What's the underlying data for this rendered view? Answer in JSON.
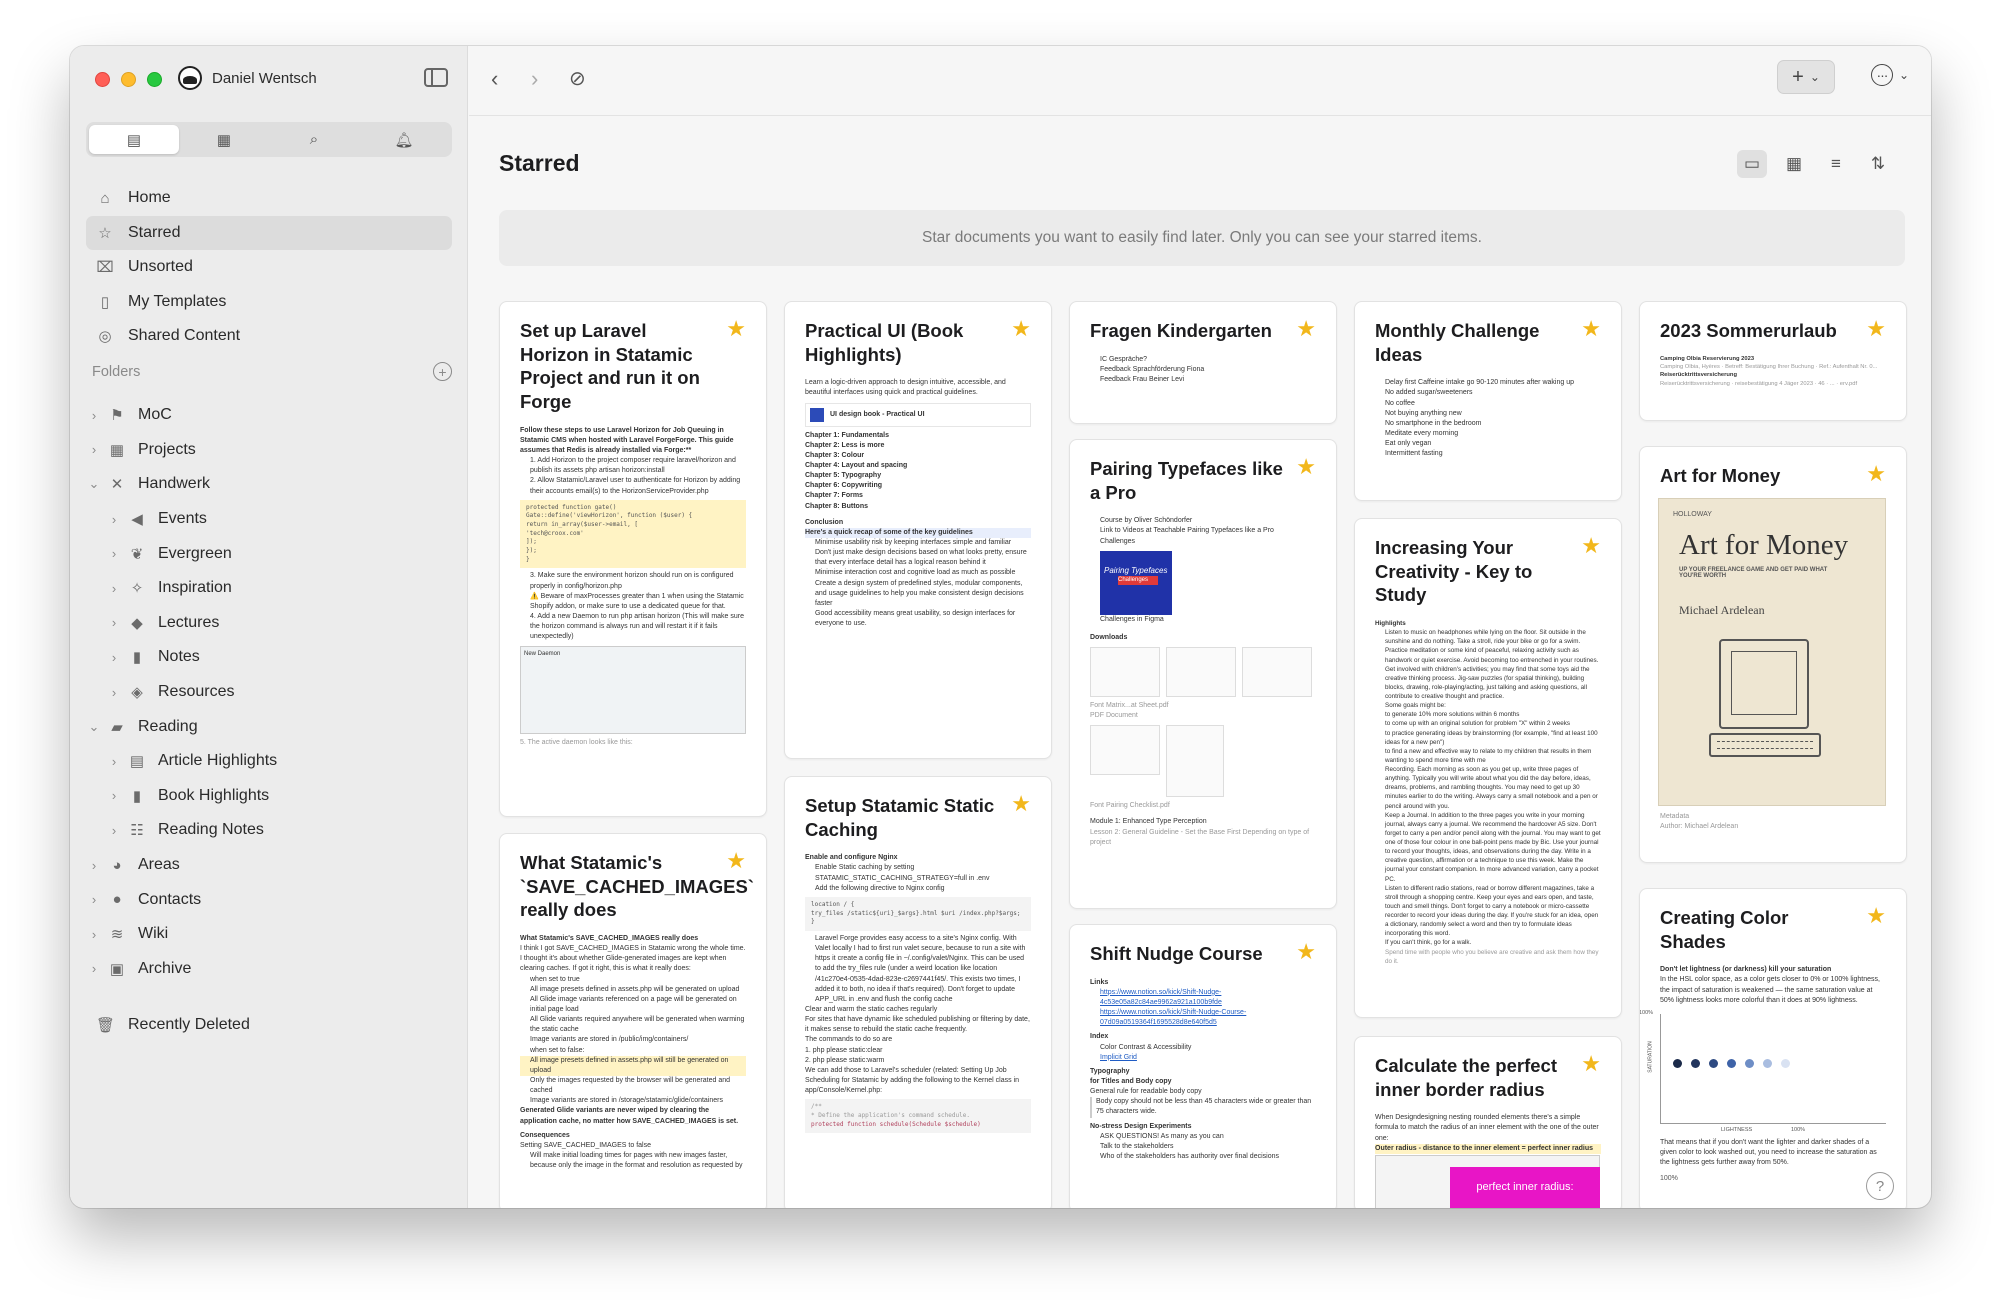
{
  "window": {
    "user_name": "Daniel Wentsch"
  },
  "sidebar": {
    "nav": [
      {
        "label": "Home",
        "icon": "home-icon"
      },
      {
        "label": "Starred",
        "icon": "star-icon"
      },
      {
        "label": "Unsorted",
        "icon": "inbox-icon"
      },
      {
        "label": "My Templates",
        "icon": "template-icon"
      },
      {
        "label": "Shared Content",
        "icon": "shared-icon"
      }
    ],
    "folders_label": "Folders",
    "tree": [
      {
        "label": "MoC",
        "level": 1,
        "icon": "signpost-icon"
      },
      {
        "label": "Projects",
        "level": 1,
        "icon": "calendar-grid-icon"
      },
      {
        "label": "Handwerk",
        "level": 1,
        "icon": "tools-icon"
      },
      {
        "label": "Events",
        "level": 2,
        "icon": "megaphone-icon"
      },
      {
        "label": "Evergreen",
        "level": 2,
        "icon": "leaf-icon"
      },
      {
        "label": "Inspiration",
        "level": 2,
        "icon": "sparkle-icon"
      },
      {
        "label": "Lectures",
        "level": 2,
        "icon": "graduation-cap-icon"
      },
      {
        "label": "Notes",
        "level": 2,
        "icon": "notebook-icon"
      },
      {
        "label": "Resources",
        "level": 2,
        "icon": "box-icon"
      },
      {
        "label": "Reading",
        "level": 1,
        "icon": "book-open-icon"
      },
      {
        "label": "Article Highlights",
        "level": 2,
        "icon": "newspaper-icon"
      },
      {
        "label": "Book Highlights",
        "level": 2,
        "icon": "bookmark-icon"
      },
      {
        "label": "Reading Notes",
        "level": 2,
        "icon": "checklist-icon"
      },
      {
        "label": "Areas",
        "level": 1,
        "icon": "pie-chart-icon"
      },
      {
        "label": "Contacts",
        "level": 1,
        "icon": "person-icon"
      },
      {
        "label": "Wiki",
        "level": 1,
        "icon": "layers-icon"
      },
      {
        "label": "Archive",
        "level": 1,
        "icon": "archive-box-icon"
      }
    ],
    "recently_deleted": "Recently Deleted"
  },
  "main": {
    "title": "Starred",
    "banner": "Star documents you want to easily find later. Only you can see your starred items."
  },
  "cards": [
    {
      "title": "Set up Laravel Horizon in Statamic Project and run it on Forge",
      "snippet": [
        "Follow these steps to use Laravel Horizon for Job Queuing in Statamic CMS when hosted with Laravel ForgeForge. This guide assumes that Redis is already installed via Forge:**",
        "1. Add Horizon to the project composer require laravel/horizon and publish its assets php artisan horizon:install",
        "2. Allow Statamic/Laravel user to authenticate for Horizon by adding their accounts email(s) to the HorizonServiceProvider.php",
        "protected function gate()",
        "Gate::define('viewHorizon', function ($user) {",
        "return in_array($user->email, [",
        "'tech@croox.com'",
        "]);",
        "});",
        "}",
        "3. Make sure the environment horizon should run on is configured properly in config/horizon.php",
        "⚠️ Beware of maxProcesses greater than 1 when using the Statamic Shopify addon, or make sure to use a dedicated queue for that.",
        "4. Add a new Daemon to run php artisan horizon (This will make sure the horizon command is always run and will restart it if it fails unexpectedly)",
        "New Daemon",
        "5. The active daemon looks like this:"
      ]
    },
    {
      "title": "What Statamic's `SAVE_CACHED_IMAGES` really does",
      "snippet": [
        "What Statamic's SAVE_CACHED_IMAGES really does",
        "I think I got SAVE_CACHED_IMAGES in Statamic wrong the whole time. I thought it's about whether Glide-generated images are kept when clearing caches. If got it right, this is what it really does:",
        "when set to true",
        "All image presets defined in assets.php will be generated on upload",
        "All Glide image variants referenced on a page will be generated on initial page load",
        "All Glide variants required anywhere will be generated when warming the static cache",
        "Image variants are stored in /public/img/containers/",
        "when set to false:",
        "All image presets defined in assets.php will still be generated on upload",
        "Only the images requested by the browser will be generated and cached",
        "Image variants are stored in /storage/statamic/glide/containers",
        "Generated Glide variants are never wiped by clearing the application cache, no matter how SAVE_CACHED_IMAGES is set.",
        "Consequences",
        "Setting SAVE_CACHED_IMAGES to false",
        "Will make initial loading times for pages with new images faster, because only the image in the format and resolution as requested by"
      ]
    },
    {
      "title": "Practical UI (Book Highlights)",
      "snippet": [
        "Learn a logic-driven approach to design intuitive, accessible, and beautiful interfaces using quick and practical guidelines.",
        "UI design book - Practical UI",
        "Chapter 1: Fundamentals",
        "Chapter 2: Less is more",
        "Chapter 3: Colour",
        "Chapter 4: Layout and spacing",
        "Chapter 5: Typography",
        "Chapter 6: Copywriting",
        "Chapter 7: Forms",
        "Chapter 8: Buttons",
        "Conclusion",
        "Here's a quick recap of some of the key guidelines",
        "Minimise usability risk by keeping interfaces simple and familiar",
        "Don't just make design decisions based on what looks pretty, ensure that every interface detail has a logical reason behind it",
        "Minimise interaction cost and cognitive load as much as possible",
        "Create a design system of predefined styles, modular components, and usage guidelines to help you make consistent design decisions faster",
        "Good accessibility means great usability, so design interfaces for everyone to use."
      ]
    },
    {
      "title": "Setup Statamic Static Caching",
      "snippet": [
        "Enable and configure Nginx",
        "Enable Static caching by setting STATAMIC_STATIC_CACHING_STRATEGY=full in .env",
        "Add the following directive to Nginx config",
        "location / {",
        "try_files /static${uri}_$args}.html $uri /index.php?$args;",
        "}",
        "Laravel Forge provides easy access to a site's Nginx config. With Valet locally I had to first run valet secure, because to run a site with https it create a config file in ~/.config/valet/Nginx. This can be used to add the try_files rule (under a weird location like location /41c270e4-0535-4dad-823e-c2697441f45/. This exists two times, I added it to both, no idea if that's required). Don't forget to update APP_URL in .env and flush the config cache",
        "Clear and warm the static caches regularly",
        "For sites that have dynamic like scheduled publishing or filtering by date, it makes sense to rebuild the static cache frequently.",
        "The commands to do so are",
        "1. php please static:clear",
        "2. php please static:warm",
        "We can add those to Laravel's scheduler (related: Setting Up Job Scheduling for Statamic by adding the following to the Kernel class in app/Console/Kernel.php:",
        "/**",
        "* Define the application's command schedule.",
        "protected function schedule(Schedule $schedule)"
      ]
    },
    {
      "title": "Fragen Kindergarten",
      "snippet": [
        "IC Gespräche?",
        "Feedback Sprachförderung Fiona",
        "Feedback Frau Beiner Levi"
      ]
    },
    {
      "title": "Pairing Typefaces like a Pro",
      "snippet": [
        "Course by Oliver Schöndorfer",
        "Link to Videos at Teachable Pairing Typefaces like a Pro",
        "Challenges",
        "Pairing Typefaces",
        "Challenges",
        "Challenges in Figma",
        "Downloads",
        "Font Matrix...at Sheet.pdf",
        "PDF Document",
        "Font Pairing Checklist.pdf",
        "Module 1: Enhanced Type Perception",
        "Lesson 2: General Guideline - Set the Base First Depending on type of project"
      ]
    },
    {
      "title": "Shift Nudge Course",
      "snippet": [
        "Links",
        "https://www.notion.so/kick/Shift-Nudge-4c53e05a82c84ae9962a921a100b9fde",
        "https://www.notion.so/kick/Shift-Nudge-Course-07d09a0519364f1695528d8e640f5d5",
        "Index",
        "Color Contrast & Accessibility",
        "Implicit Grid",
        "Typography",
        "for Titles and Body copy",
        "General rule for readable body copy",
        "Body copy should not be less than 45 characters wide or greater than 75 characters wide.",
        "No-stress Design Experiments",
        "ASK QUESTIONS! As many as you can",
        "Talk to the stakeholders",
        "Who of the stakeholders has authority over final decisions"
      ]
    },
    {
      "title": "Monthly Challenge Ideas",
      "snippet": [
        "Delay first Caffeine intake go 90-120 minutes after waking up",
        "No added sugar/sweeteners",
        "No coffee",
        "Not buying anything new",
        "No smartphone in the bedroom",
        "Meditate every morning",
        "Eat only vegan",
        "Intermittent fasting"
      ]
    },
    {
      "title": "Increasing Your Creativity - Key to Study",
      "snippet": [
        "Highlights",
        "Listen to music on headphones while lying on the floor. Sit outside in the sunshine and do nothing. Take a stroll, ride your bike or go for a swim.",
        "Practice meditation or some kind of peaceful, relaxing activity such as handwork or quiet exercise. Avoid becoming too entrenched in your routines.",
        "Get involved with children's activities; you may find that some toys aid the creative thinking process. Jig-saw puzzles (for spatial thinking), building blocks, drawing, role-playing/acting, just talking and asking questions, all contribute to creative thought and practice.",
        "Some goals might be:",
        "to generate 10% more solutions within 6 months",
        "to come up with an original solution for problem \"X\" within 2 weeks",
        "to practice generating ideas by brainstorming (for example, \"find at least 100 ideas for a new pen\")",
        "to find a new and effective way to relate to my children that results in them wanting to spend more time with me",
        "Recording. Each morning as soon as you get up, write three pages of anything. Typically you will write about what you did the day before, ideas, dreams, problems, and rambling thoughts. You may need to get up 30 minutes earlier to do the writing. Always carry a small notebook and a pen or pencil around with you.",
        "Keep a Journal. In addition to the three pages you write in your morning journal, always carry a journal. We recommend the hardcover A5 size. Don't forget to carry a pen and/or pencil along with the journal. You may want to get one of those four colour in one ball-point pens made by Bic. Use your journal to record your thoughts, ideas, and observations during the day. Write in a creative question, affirmation or a technique to use this week. Make the journal your constant companion. In more advanced variation, carry a pocket PC.",
        "Listen to different radio stations, read or borrow different magazines, take a stroll through a shopping centre. Keep your eyes and ears open, and taste, touch and smell things. Don't forget to carry a notebook or micro-cassette recorder to record your ideas during the day. If you're stuck for an idea, open a dictionary, randomly select a word and then try to formulate ideas incorporating this word.",
        "If you can't think, go for a walk.",
        "Spend time with people who you believe are creative and ask them how they do it."
      ]
    },
    {
      "title": "Calculate the perfect inner border radius",
      "snippet": [
        "When Designdesigning nesting rounded elements there's a simple formula to match the radius of an inner element with the one of the outer one:",
        "Outer radius - distance to the inner element = perfect inner radius",
        "perfect",
        "inner radius:"
      ]
    },
    {
      "title": "2023 Sommerurlaub",
      "snippet": [
        "Camping Olbia Reservierung 2023",
        "Camping Olbia, Hyères · Betreff: Bestätigung Ihrer Buchung · Ref.: Aufenthalt Nr. 0...",
        "Reiserücktrittsversicherung",
        "Reiserücktrittsversicherung · reisebestätigung 4 Jäger 2023 · 46 · ... · erv.pdf"
      ]
    },
    {
      "title": "Art for Money",
      "snippet": [
        "HOLLOWAY",
        "Art for Money",
        "UP YOUR FREELANCE GAME AND GET PAID WHAT YOU'RE WORTH",
        "Michael Ardelean",
        "Metadata",
        "Author: Michael Ardelean"
      ]
    },
    {
      "title": "Creating Color Shades",
      "snippet": [
        "Don't let lightness (or darkness) kill your saturation",
        "In the HSL color space, as a color gets closer to 0% or 100% lightness, the impact of saturation is weakened — the same saturation value at 50% lightness looks more colorful than it does at 90% lightness.",
        "100%",
        "SATURATION",
        "LIGHTNESS",
        "100%",
        "That means that if you don't want the lighter and darker shades of a given color to look washed out, you need to increase the saturation as the lightness gets further away from 50%.",
        "100%"
      ]
    }
  ],
  "colors": {
    "star": "#f2b71b",
    "accent_pink": "#e815c6",
    "link": "#1f5cc4"
  }
}
